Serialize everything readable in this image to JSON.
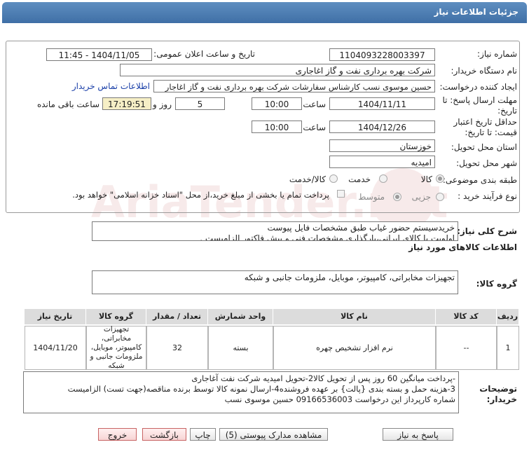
{
  "header": {
    "title": "جزئیات اطلاعات نیاز"
  },
  "form": {
    "need_number_label": "شماره نیاز:",
    "need_number": "1104093228003397",
    "announce_label": "تاریخ و ساعت اعلان عمومی:",
    "announce_value": "1404/11/05 - 11:45",
    "buyer_org_label": "نام دستگاه خریدار:",
    "buyer_org": "شرکت بهره برداری نفت و گاز اغاجاری",
    "creator_label": "ایجاد کننده درخواست:",
    "creator": "حسین موسوی نسب کارشناس سفارشات شرکت بهره برداری نفت و گاز اغاجار",
    "contact_link": "اطلاعات تماس خریدار",
    "deadline_label_1": "مهلت ارسال پاسخ: تا",
    "deadline_label_2": "تاریخ:",
    "deadline_date": "1404/11/11",
    "time_label": "ساعت",
    "deadline_time": "10:00",
    "days_value": "5",
    "days_label": "روز و",
    "remaining_time": "17:19:51",
    "remaining_label": "ساعت باقی مانده",
    "validity_label_1": "حداقل تاریخ اعتبار",
    "validity_label_2": "قیمت: تا تاریخ:",
    "validity_date": "1404/12/26",
    "validity_time": "10:00",
    "province_label": "استان محل تحویل:",
    "province": "خوزستان",
    "city_label": "شهر محل تحویل:",
    "city": "امیدیه",
    "category_label": "طبقه بندی موضوعی:",
    "category_options": [
      "کالا",
      "خدمت",
      "کالا/خدمت"
    ],
    "process_label": "نوع فرآیند خرید :",
    "process_options": [
      "جزیی",
      "متوسط"
    ],
    "payment_note": "پرداخت تمام یا بخشی از مبلغ خرید،از محل \"اسناد خزانه اسلامی\" خواهد بود."
  },
  "description": {
    "label": "شرح کلی نیاز:",
    "line1": "خریدسیستم حضور غیاب طبق مشخصات فایل پیوست",
    "line2": "اولویت با کالای ایرانی،بارگذاری مشخصات فنی و پیش فاکتور الزامیست ."
  },
  "goods_info_title": "اطلاعات کالاهای مورد نیاز",
  "goods_group": {
    "label": "گروه کالا:",
    "value": "تجهیزات مخابراتی، کامپیوتر، موبایل، ملزومات جانبی و شبکه"
  },
  "table": {
    "headers": [
      "ردیف",
      "کد کالا",
      "نام کالا",
      "واحد شمارش",
      "تعداد / مقدار",
      "گروه کالا",
      "تاریخ نیاز"
    ],
    "row": {
      "index": "1",
      "code": "--",
      "name": "نرم افزار تشخیص چهره",
      "unit": "بسته",
      "qty": "32",
      "group": "تجهیزات مخابراتی، کامپیوتر، موبایل، ملزومات جانبی و شبکه",
      "date": "1404/11/20"
    }
  },
  "buyer_notes": {
    "label_1": "توضیحات",
    "label_2": "خریدار:",
    "line1": "-پرداخت میانگین 60 روز پس از تحویل کالا2-تحویل امیدیه شرکت نفت آغاجاری",
    "line2": "3-هزینه حمل  و بسته بندی {پالت} بر عهده فروشنده4-ارسال نمونه کالا توسط برنده مناقصه(جهت تست) الزامیست",
    "line3": "شماره کارپرداز این درخواست 09166536003 حسین موسوی نسب"
  },
  "buttons": {
    "reply": "پاسخ به نیاز",
    "attachments": "مشاهده مدارک پیوستی (5)",
    "print": "چاپ",
    "back": "بازگشت",
    "exit": "خروج"
  },
  "watermark_text": "AriaTender.net"
}
